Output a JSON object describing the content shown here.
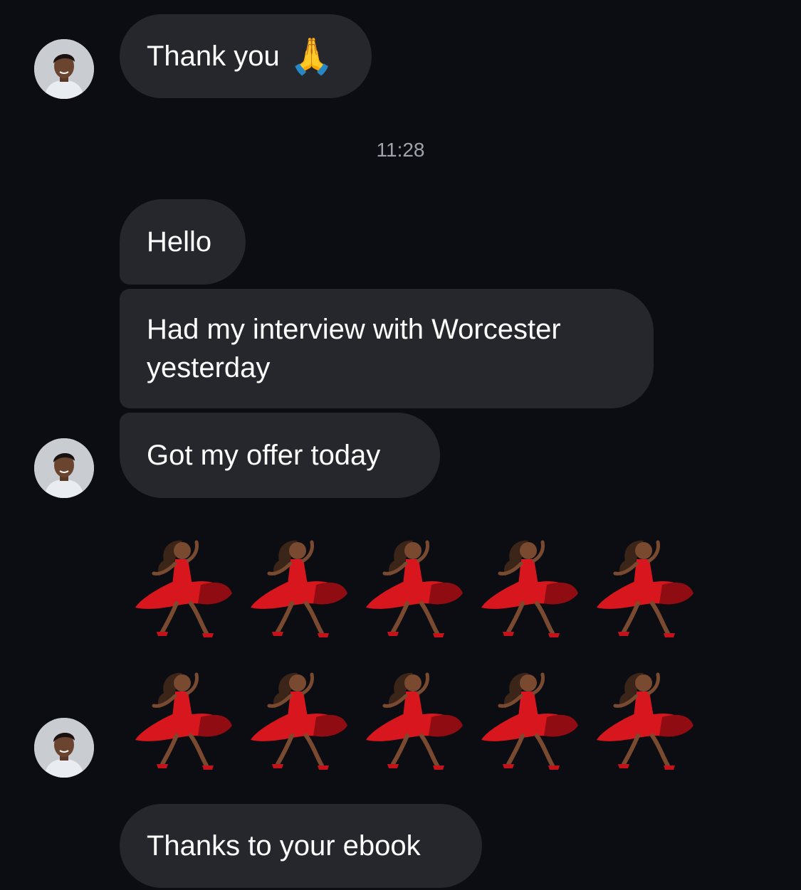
{
  "conversation": {
    "messages": [
      {
        "text": "Thank you",
        "emoji": "🙏"
      },
      {
        "timestamp": "11:28"
      },
      {
        "text": "Hello"
      },
      {
        "text": "Had my interview with Worcester yesterday"
      },
      {
        "text": "Got my offer today"
      },
      {
        "emoji_grid": {
          "emoji": "💃🏾",
          "rows": 2,
          "per_row": 5,
          "icon": "dancing-woman-icon"
        }
      },
      {
        "text": "Thanks to your ebook"
      }
    ]
  },
  "colors": {
    "background": "#0b0d12",
    "bubble": "#25272c",
    "text": "#ffffff",
    "timestamp": "#9ea3ab",
    "dress": "#d8161e"
  }
}
